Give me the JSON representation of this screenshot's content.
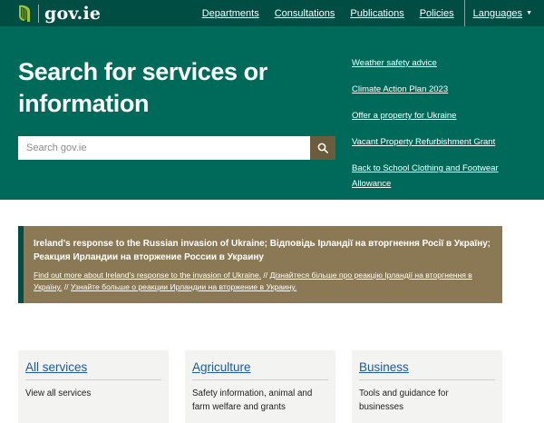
{
  "header": {
    "logo_text": "gov.ie",
    "nav": [
      "Departments",
      "Consultations",
      "Publications",
      "Policies"
    ],
    "language_label": "Languages"
  },
  "hero": {
    "title": "Search for services or information",
    "search_placeholder": "Search gov.ie",
    "quick_links": [
      "Weather safety advice",
      "Climate Action Plan 2023",
      "Offer a property for Ukraine",
      "Vacant Property Refurbishment Grant",
      "Back to School Clothing and Footwear Allowance"
    ]
  },
  "alert": {
    "title": "Ireland's response to the Russian invasion of Ukraine; Відповідь Ірландії на вторгнення Росії в Україну; Реакция Ирландии на вторжение России в Украину",
    "link_en": "Find out more about Ireland's response to the invasion of Ukraine.",
    "separator": " // ",
    "link_uk": "Дізнайтеся більше про реакцію Ірландії на вторгнення в Україну.",
    "link_ru": "Узнайте больше о реакции Ирландии на вторжение в Украину."
  },
  "cards": [
    {
      "title": "All services",
      "description": "View all services"
    },
    {
      "title": "Agriculture",
      "description": "Safety information, animal and farm welfare and grants"
    },
    {
      "title": "Business",
      "description": "Tools and guidance for businesses"
    }
  ],
  "colors": {
    "header_bg": "#004d44",
    "hero_bg": "#006a5a",
    "search_button_bg": "#6b5c3e",
    "alert_bg": "#8b7955",
    "card_bg": "#f3f3f1",
    "link_blue": "#1b5a9c"
  },
  "icons": {
    "logo": "harp-icon",
    "search": "search-icon",
    "language_dropdown": "chevron-down-icon"
  }
}
